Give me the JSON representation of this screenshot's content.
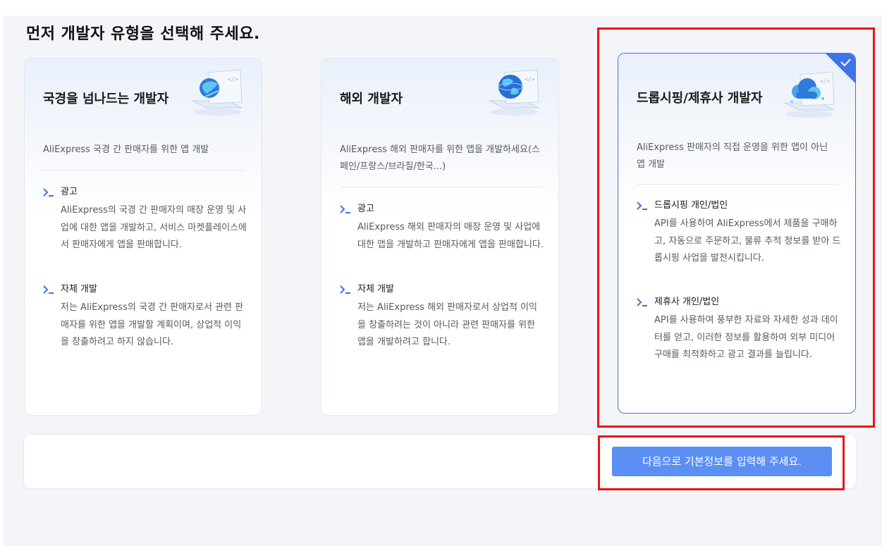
{
  "page": {
    "title": "먼저 개발자 유형을 선택해 주세요."
  },
  "cards": [
    {
      "title": "국경을 넘나드는 개발자",
      "description": "AliExpress 국경 간 판매자를 위한 앱 개발",
      "selected": false,
      "features": [
        {
          "label": "광고",
          "text": "AliExpress의 국경 간 판매자의 매장 운영 및 사업에 대한 앱을 개발하고, 서비스 마켓플레이스에서 판매자에게 앱을 판매합니다."
        },
        {
          "label": "자체 개발",
          "text": "저는 AliExpress의 국경 간 판매자로서 관련 판매자를 위한 앱을 개발할 계획이며, 상업적 이익을 창출하려고 하지 않습니다."
        }
      ]
    },
    {
      "title": "해외 개발자",
      "description": "AliExpress 해외 판매자를 위한 앱을 개발하세요(스페인/프랑스/브라질/한국...)",
      "selected": false,
      "features": [
        {
          "label": "광고",
          "text": "AliExpress 해외 판매자의 매장 운영 및 사업에 대한 앱을 개발하고 판매자에게 앱을 판매합니다."
        },
        {
          "label": "자체 개발",
          "text": "저는 AliExpress 해외 판매자로서 상업적 이익을 창출하려는 것이 아니라 관련 판매자를 위한 앱을 개발하려고 합니다."
        }
      ]
    },
    {
      "title": "드롭시핑/제휴사 개발자",
      "description": "AliExpress 판매자의 직접 운영을 위한 앱이 아닌 앱 개발",
      "selected": true,
      "features": [
        {
          "label": "드롭시핑 개인/법인",
          "text": "API를 사용하여 AliExpress에서 제품을 구매하고, 자동으로 주문하고, 물류 추적 정보를 받아 드롭시핑 사업을 발전시킵니다."
        },
        {
          "label": "제휴사 개인/법인",
          "text": "API를 사용하여 풍부한 자료와 자세한 성과 데이터를 얻고, 이러한 정보를 활용하여 외부 미디어 구매를 최적화하고 광고 결과를 늘립니다."
        }
      ]
    }
  ],
  "footer": {
    "next_button_label": "다음으로 기본정보를 입력해 주세요."
  },
  "icons": {
    "feature_icon": "terminal-prompt-icon",
    "selected_icon": "checkmark-icon",
    "card_illustrations": [
      "laptop-globe-illustration",
      "laptop-earth-illustration",
      "laptop-cloud-illustration"
    ]
  },
  "colors": {
    "accent": "#3f73e8",
    "button": "#5b8ff3",
    "highlight": "#e8141b",
    "background": "#f3f5f9"
  }
}
